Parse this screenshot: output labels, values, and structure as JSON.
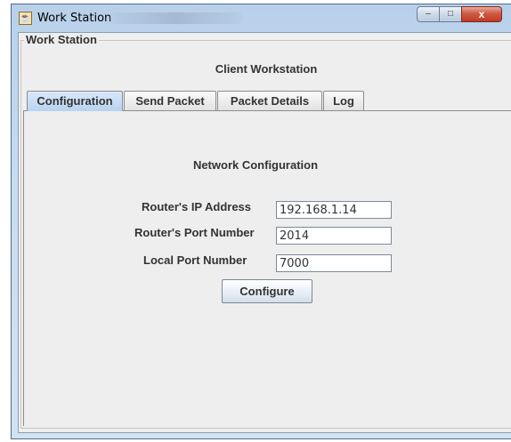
{
  "window": {
    "title": "Work Station",
    "controls": {
      "minimize": "–",
      "maximize": "□",
      "close": "x"
    }
  },
  "group": {
    "title": "Work Station"
  },
  "panel": {
    "title": "Client Workstation"
  },
  "tabs": [
    {
      "label": "Configuration",
      "active": true
    },
    {
      "label": "Send Packet",
      "active": false
    },
    {
      "label": "Packet Details",
      "active": false
    },
    {
      "label": "Log",
      "active": false
    }
  ],
  "network_config": {
    "title": "Network Configuration",
    "router_ip": {
      "label": "Router's IP Address",
      "value": "192.168.1.14"
    },
    "router_port": {
      "label": "Router's Port Number",
      "value": "2014"
    },
    "local_port": {
      "label": "Local Port Number",
      "value": "7000"
    },
    "configure_button": "Configure"
  }
}
